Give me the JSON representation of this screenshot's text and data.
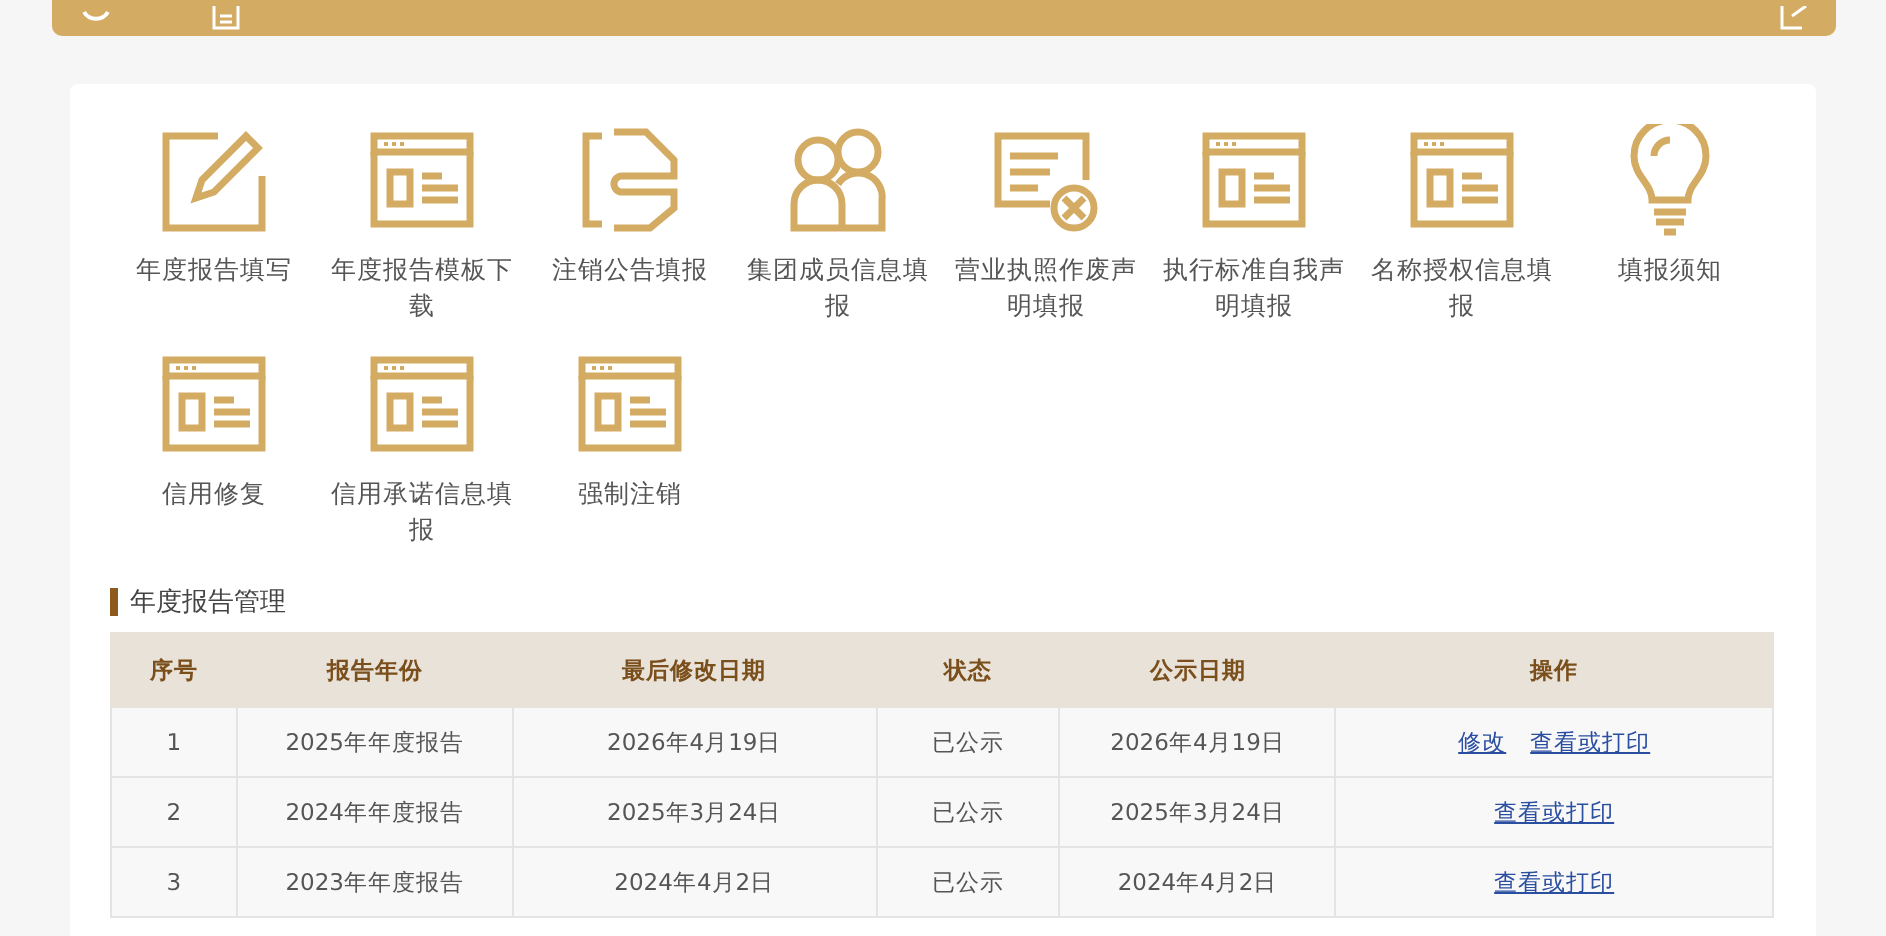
{
  "shortcuts": [
    {
      "label": "年度报告填写",
      "kind": "edit"
    },
    {
      "label": "年度报告模板下载",
      "kind": "form"
    },
    {
      "label": "注销公告填报",
      "kind": "clip"
    },
    {
      "label": "集团成员信息填报",
      "kind": "people"
    },
    {
      "label": "营业执照作废声明填报",
      "kind": "cancel"
    },
    {
      "label": "执行标准自我声明填报",
      "kind": "form"
    },
    {
      "label": "名称授权信息填报",
      "kind": "form"
    },
    {
      "label": "填报须知",
      "kind": "bulb"
    },
    {
      "label": "信用修复",
      "kind": "form"
    },
    {
      "label": "信用承诺信息填报",
      "kind": "form"
    },
    {
      "label": "强制注销",
      "kind": "form"
    }
  ],
  "section_title": "年度报告管理",
  "table": {
    "columns": [
      "序号",
      "报告年份",
      "最后修改日期",
      "状态",
      "公示日期",
      "操作"
    ],
    "rows": [
      {
        "cells": [
          "1",
          "2025年年度报告",
          "2026年4月19日",
          "已公示",
          "2026年4月19日"
        ],
        "actions": [
          "修改",
          "查看或打印"
        ]
      },
      {
        "cells": [
          "2",
          "2024年年度报告",
          "2025年3月24日",
          "已公示",
          "2025年3月24日"
        ],
        "actions": [
          "查看或打印"
        ]
      },
      {
        "cells": [
          "3",
          "2023年年度报告",
          "2024年4月2日",
          "已公示",
          "2024年4月2日"
        ],
        "actions": [
          "查看或打印"
        ]
      }
    ]
  }
}
